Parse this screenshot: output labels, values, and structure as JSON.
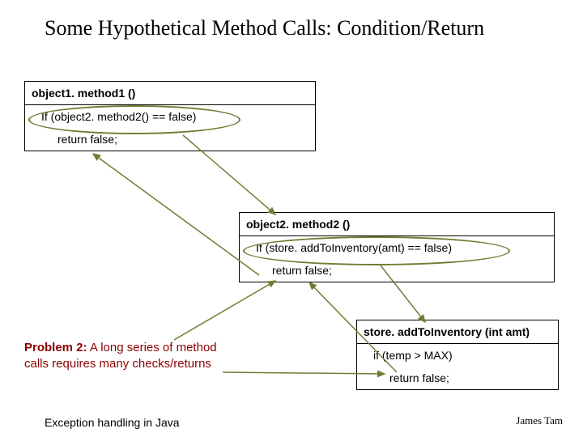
{
  "title": "Some Hypothetical Method Calls: Condition/Return",
  "box1": {
    "header": "object1. method1 ()",
    "line1": "If (object2. method2() == false)",
    "line2": "return false;"
  },
  "box2": {
    "header": "object2. method2 ()",
    "line1": "If (store. addToInventory(amt) == false)",
    "line2": "return false;"
  },
  "box3": {
    "header": "store. addToInventory (int amt)",
    "line1": "if (temp > MAX)",
    "line2": "return false;"
  },
  "problem": {
    "label": "Problem 2:",
    "text": "  A long series of method calls requires many checks/returns"
  },
  "footer": {
    "left": "Exception handling in Java",
    "right": "James Tam"
  }
}
